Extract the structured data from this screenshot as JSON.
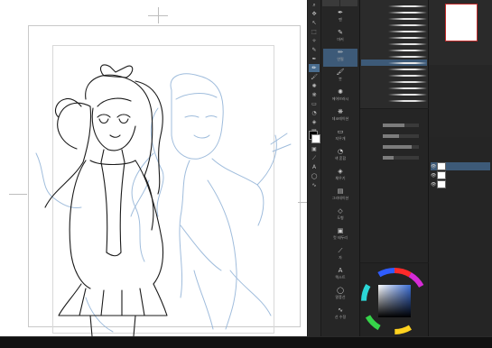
{
  "canvas": {
    "status_left": "",
    "status_right": ""
  },
  "toolstrip": {
    "tools": [
      {
        "icon": "zoom-icon",
        "glyph": "⌕"
      },
      {
        "icon": "move-icon",
        "glyph": "✥"
      },
      {
        "icon": "operation-icon",
        "glyph": "↖"
      },
      {
        "icon": "selection-icon",
        "glyph": "⬚"
      },
      {
        "icon": "auto-select-icon",
        "glyph": "✧"
      },
      {
        "icon": "eyedropper-icon",
        "glyph": "✎"
      },
      {
        "icon": "pen-icon",
        "glyph": "✒"
      },
      {
        "icon": "pencil-icon",
        "glyph": "✏"
      },
      {
        "icon": "brush-icon",
        "glyph": "🖌"
      },
      {
        "icon": "airbrush-icon",
        "glyph": "✺"
      },
      {
        "icon": "decoration-icon",
        "glyph": "❋"
      },
      {
        "icon": "eraser-icon",
        "glyph": "▭"
      },
      {
        "icon": "blend-icon",
        "glyph": "◔"
      },
      {
        "icon": "fill-icon",
        "glyph": "◈"
      },
      {
        "icon": "gradient-icon",
        "glyph": "▤"
      },
      {
        "icon": "figure-icon",
        "glyph": "◇"
      },
      {
        "icon": "frame-icon",
        "glyph": "▣"
      },
      {
        "icon": "ruler-icon",
        "glyph": "⟋"
      },
      {
        "icon": "text-icon",
        "glyph": "A"
      },
      {
        "icon": "balloon-icon",
        "glyph": "◯"
      },
      {
        "icon": "line-correct-icon",
        "glyph": "∿"
      }
    ],
    "active_index": 7,
    "colors": {
      "main": "#000000",
      "sub": "#ffffff"
    }
  },
  "subtool": {
    "tabs": [
      "",
      ""
    ],
    "items": [
      {
        "icon": "pen-tool-icon",
        "glyph": "✒",
        "label": "펜"
      },
      {
        "icon": "marker-tool-icon",
        "glyph": "✎",
        "label": "마커"
      },
      {
        "icon": "pencil-tool-icon",
        "glyph": "✏",
        "label": "연필"
      },
      {
        "icon": "brush-tool-icon",
        "glyph": "🖌",
        "label": "붓"
      },
      {
        "icon": "airbrush-tool-icon",
        "glyph": "✺",
        "label": "에어브러시"
      },
      {
        "icon": "decoration-tool-icon",
        "glyph": "❋",
        "label": "데코레이션"
      },
      {
        "icon": "eraser-tool-icon",
        "glyph": "▭",
        "label": "지우개"
      },
      {
        "icon": "blend-tool-icon",
        "glyph": "◔",
        "label": "색 혼합"
      },
      {
        "icon": "fill-tool-icon",
        "glyph": "◈",
        "label": "채우기"
      },
      {
        "icon": "gradient-tool-icon",
        "glyph": "▤",
        "label": "그라데이션"
      },
      {
        "icon": "figure-tool-icon",
        "glyph": "◇",
        "label": "도형"
      },
      {
        "icon": "frame-tool-icon",
        "glyph": "▣",
        "label": "컷 테두리"
      },
      {
        "icon": "ruler-tool-icon",
        "glyph": "⟋",
        "label": "자"
      },
      {
        "icon": "text-tool-icon",
        "glyph": "A",
        "label": "텍스트"
      },
      {
        "icon": "balloon-tool-icon",
        "glyph": "◯",
        "label": "말풍선"
      },
      {
        "icon": "correction-tool-icon",
        "glyph": "∿",
        "label": "선 수정"
      }
    ],
    "selected_index": 2
  },
  "brushes": {
    "items": [
      {
        "name": ""
      },
      {
        "name": ""
      },
      {
        "name": ""
      },
      {
        "name": ""
      },
      {
        "name": ""
      },
      {
        "name": ""
      },
      {
        "name": ""
      },
      {
        "name": ""
      },
      {
        "name": ""
      },
      {
        "name": ""
      },
      {
        "name": ""
      },
      {
        "name": ""
      },
      {
        "name": ""
      },
      {
        "name": ""
      },
      {
        "name": ""
      },
      {
        "name": ""
      }
    ],
    "selected_index": 9
  },
  "toolprop": {
    "rows": [
      {
        "label": "",
        "level": 0.6
      },
      {
        "label": "",
        "level": 0.45
      },
      {
        "label": "",
        "level": 0.8
      },
      {
        "label": "",
        "level": 0.3
      }
    ]
  },
  "layers": {
    "items": [
      {
        "name": "",
        "eye": "👁"
      },
      {
        "name": "",
        "eye": "👁"
      },
      {
        "name": "",
        "eye": "👁"
      }
    ],
    "selected_index": 0
  }
}
